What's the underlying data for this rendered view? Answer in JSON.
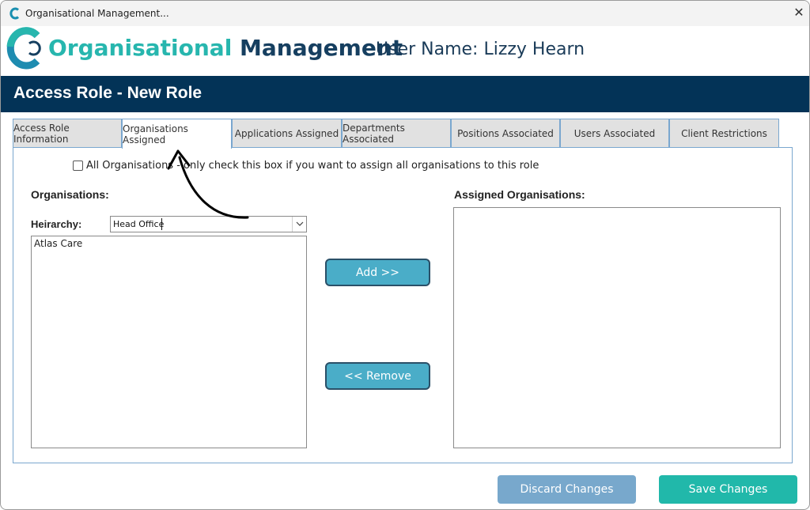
{
  "window": {
    "title": "Organisational Management...",
    "close_glyph": "✕"
  },
  "header": {
    "brand_part1": "Organisational",
    "brand_part2": "Management",
    "username": "User Name: Lizzy Hearn"
  },
  "banner": {
    "title": "Access Role - New Role"
  },
  "tabs": [
    {
      "label": "Access Role Information",
      "active": false
    },
    {
      "label": "Organisations Assigned",
      "active": true
    },
    {
      "label": "Applications Assigned",
      "active": false
    },
    {
      "label": "Departments Associated",
      "active": false
    },
    {
      "label": "Positions Associated",
      "active": false
    },
    {
      "label": "Users Associated",
      "active": false
    },
    {
      "label": "Client Restrictions",
      "active": false
    }
  ],
  "all_orgs": {
    "label": "All Organisations - only check this box if you want to assign all organisations to this role",
    "checked": false
  },
  "organisations": {
    "heading": "Organisations:",
    "hierarchy_label": "Heirarchy:",
    "hierarchy_value": "Head Office",
    "items": [
      "Atlas Care"
    ]
  },
  "assigned": {
    "heading": "Assigned Organisations:",
    "items": []
  },
  "buttons": {
    "add": "Add  >>",
    "remove": "<< Remove",
    "discard": "Discard Changes",
    "save": "Save Changes"
  },
  "colors": {
    "brand_teal": "#27b6ae",
    "brand_navy": "#163f60",
    "banner": "#033357",
    "action_button": "#4aadc8",
    "discard": "#78a8cc",
    "save": "#21b8aa"
  },
  "icons": {
    "app": "c-logo-icon",
    "close": "close-icon",
    "dropdown": "chevron-down-icon",
    "annotation": "curved-arrow-annotation"
  }
}
